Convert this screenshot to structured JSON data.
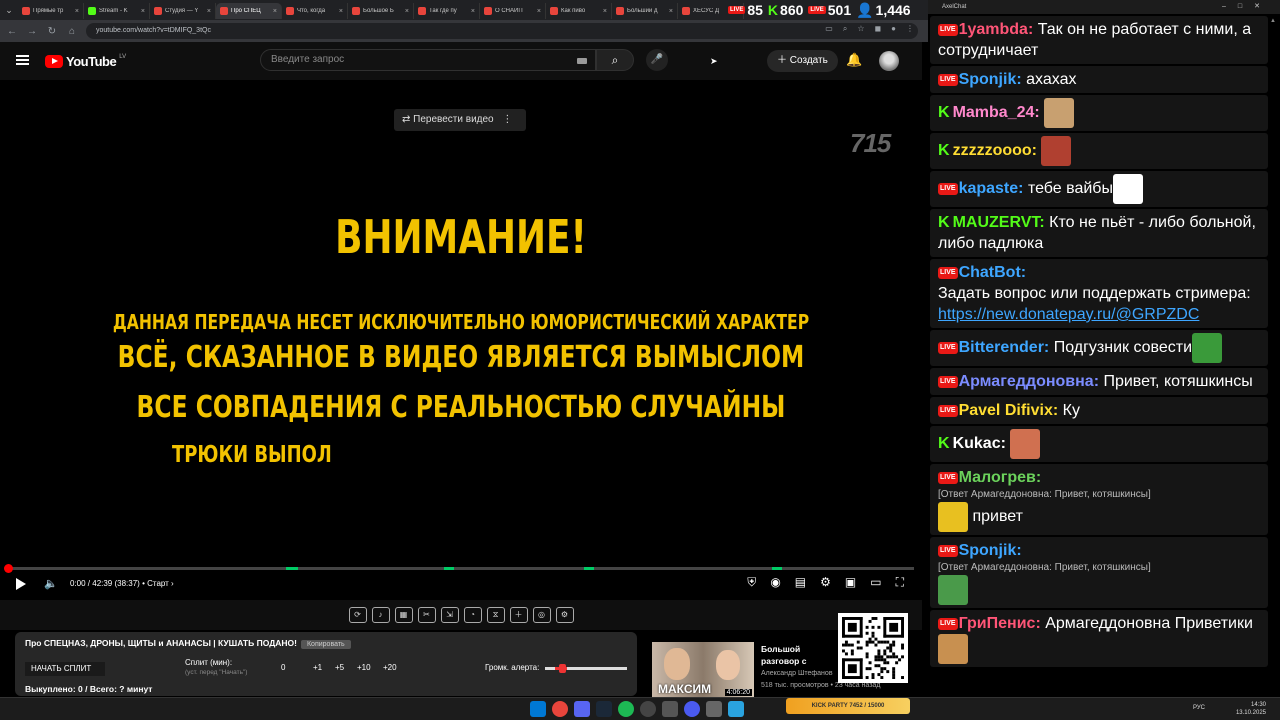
{
  "browser": {
    "tabs": [
      {
        "label": "Прямые тр",
        "color": "#e8453c"
      },
      {
        "label": "Stream - K",
        "color": "#53fc18"
      },
      {
        "label": "Студия — Y",
        "color": "#e8453c"
      },
      {
        "label": "Про СПЕЦ",
        "color": "#e8453c"
      },
      {
        "label": "Что, когда",
        "color": "#e8453c"
      },
      {
        "label": "Большое Б",
        "color": "#e8453c"
      },
      {
        "label": "Так где пу",
        "color": "#e8453c"
      },
      {
        "label": "О СНАЙП",
        "color": "#e8453c"
      },
      {
        "label": "Как пиво",
        "color": "#e8453c"
      },
      {
        "label": "Больший д",
        "color": "#e8453c"
      },
      {
        "label": "ХЕСУС Д",
        "color": "#e8453c"
      }
    ],
    "url": "youtube.com/watch?v=tDMIFQ_3tQc"
  },
  "overlay_stats": {
    "twitch": "85",
    "kick": "860",
    "live": "501",
    "viewers": "1,446"
  },
  "youtube": {
    "logo_text": "YouTube",
    "country": "LV",
    "search_placeholder": "Введите запрос",
    "create_label": "Создать"
  },
  "video": {
    "translate_label": "Перевести видео",
    "watermark": "715",
    "warning_title": "ВНИМАНИЕ!",
    "warning_lines": [
      "ДАННАЯ ПЕРЕДАЧА НЕСЕТ ИСКЛЮЧИТЕЛЬНО ЮМОРИСТИЧЕСКИЙ ХАРАКТЕР",
      "ВСЁ, СКАЗАННОЕ В ВИДЕО ЯВЛЯЕТСЯ ВЫМЫСЛОМ",
      "ВСЕ СОВПАДЕНИЯ С РЕАЛЬНОСТЬЮ СЛУЧАЙНЫ",
      "ТРЮКИ ВЫПОЛ"
    ],
    "time": "0:00 / 42:39 (38:37)",
    "chapter": "• Старт ›",
    "progress": 0
  },
  "split_panel": {
    "title": "Про СПЕЦНАЗ, ДРОНЫ, ЩИТЫ и АНАНАСЫ | КУШАТЬ ПОДАНО!",
    "copy_label": "Копировать",
    "start_label": "НАЧАТЬ СПЛИТ",
    "split_label": "Сплит (мин):",
    "split_hint": "(уст. перед \"Начать\")",
    "split_values": [
      "0",
      "+1",
      "+5",
      "+10",
      "+20"
    ],
    "alert_label": "Громк. алерта:",
    "footer": "Выкуплено: 0 / Всего: ? минут"
  },
  "recommendation": {
    "thumb_caption": "МАКСИМ",
    "duration": "4:06:20",
    "title": "Большой разговор с Максимом Кацем",
    "channel": "Александр Штефанов",
    "views": "518 тыс. просмотров • 23 часа назад"
  },
  "chat": {
    "window_title": "AxelChat",
    "messages": [
      {
        "platform": "live",
        "nick": "1yambda",
        "color": "#ff5577",
        "text": "Так он не работает с ними, а сотрудничает"
      },
      {
        "platform": "live",
        "nick": "Sponjik",
        "color": "#3ea6ff",
        "text": "ахахах"
      },
      {
        "platform": "kick",
        "nick": "Mamba_24",
        "color": "#ff88cc",
        "text": "",
        "emote": "#c8a070"
      },
      {
        "platform": "kick",
        "nick": "zzzzzoooo",
        "color": "#ffdd33",
        "text": "",
        "emote": "#b04030"
      },
      {
        "platform": "live",
        "nick": "kapaste",
        "color": "#3ea6ff",
        "text": "тебе вайбы",
        "emote": "#ffffff"
      },
      {
        "platform": "kick",
        "nick": "MAUZERVT",
        "color": "#53fc18",
        "text": "Кто не пьёт - либо больной, либо падлюка"
      },
      {
        "platform": "live",
        "nick": "ChatBot",
        "color": "#3ea6ff",
        "text": "Задать вопрос или поддержать стримера:",
        "link": "https://new.donatepay.ru/@GRPZDC"
      },
      {
        "platform": "live",
        "nick": "Bitterender",
        "color": "#3ea6ff",
        "text": "Подгузник совести",
        "emote": "#3a9a3a"
      },
      {
        "platform": "live",
        "nick": "Армагеддоновна",
        "color": "#7b8cff",
        "text": "Привет, котяшкинсы"
      },
      {
        "platform": "live",
        "nick": "Pavel Difivix",
        "color": "#ffdd33",
        "text": "Ку"
      },
      {
        "platform": "kick",
        "nick": "Kukac",
        "color": "#ffffff",
        "text": "",
        "emote": "#d07050"
      },
      {
        "platform": "live",
        "nick": "Малогрев",
        "color": "#6bd15b",
        "reply": "[Ответ Армагеддоновна: Привет, котяшкинсы]",
        "text": "привет",
        "emote": "#e8c020"
      },
      {
        "platform": "live",
        "nick": "Sponjik",
        "color": "#3ea6ff",
        "reply": "[Ответ Армагеддоновна: Привет, котяшкинсы]",
        "text": "",
        "emote": "#4a9a4a"
      },
      {
        "platform": "live",
        "nick": "ГриПенис",
        "color": "#ff5577",
        "text": "Армагеддоновна Приветики",
        "emote": "#c89050"
      }
    ]
  },
  "taskbar": {
    "lang": "РУС",
    "time": "14:30",
    "date": "13.10.2025",
    "kick_banner": "KICK PARTY  7452 / 15000"
  }
}
